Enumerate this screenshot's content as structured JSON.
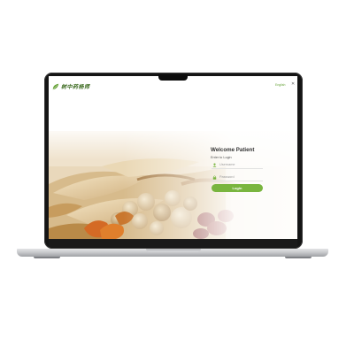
{
  "app": {
    "logo_text": "树中药杨师",
    "logo_icon": "leaf-icon",
    "language_label": "English",
    "close_icon": "close-icon"
  },
  "login": {
    "title": "Welcome Patient",
    "subtitle": "Enter to Login",
    "username_placeholder": "Username",
    "password_placeholder": "Password",
    "login_button": "Login",
    "username_icon": "user-icon",
    "password_icon": "lock-icon"
  },
  "colors": {
    "accent": "#79b53f",
    "logo": "#3b6a1f",
    "bezel": "#151515",
    "chassis": "#c9cacd"
  }
}
